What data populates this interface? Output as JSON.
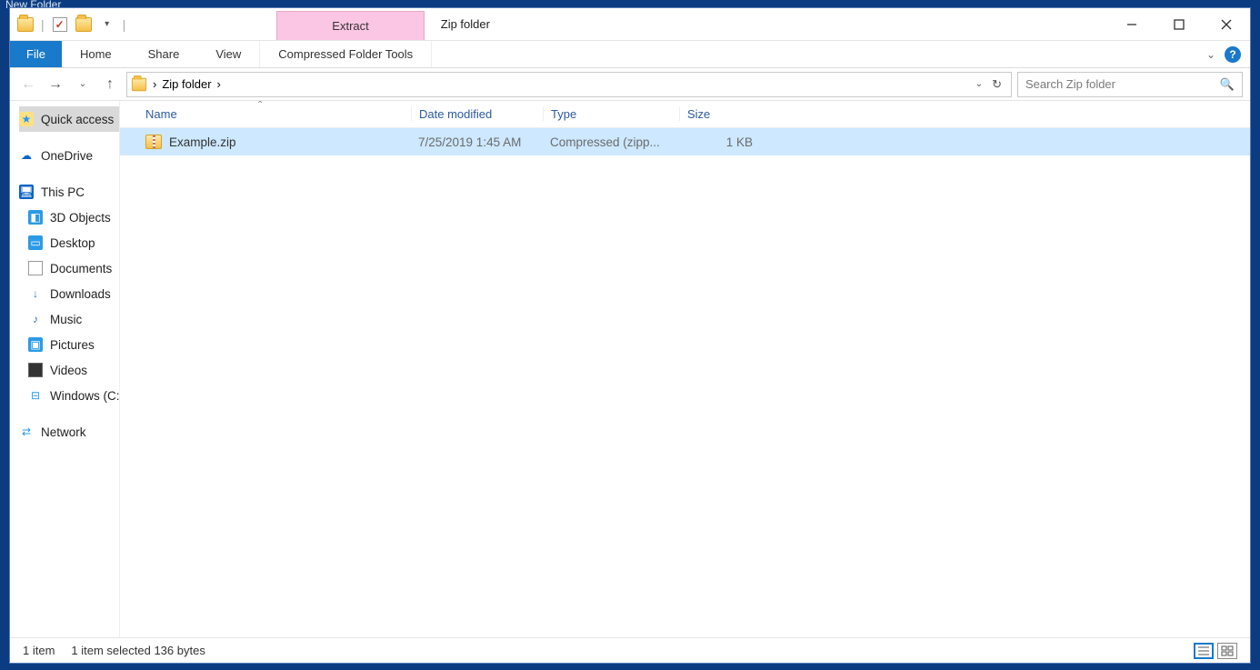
{
  "desktop_label": "New Folder",
  "window": {
    "title": "Zip folder"
  },
  "ribbon": {
    "context_tab": "Extract",
    "tabs": [
      "File",
      "Home",
      "Share",
      "View",
      "Compressed Folder Tools"
    ]
  },
  "address": {
    "crumbs": [
      "Zip folder"
    ]
  },
  "search": {
    "placeholder": "Search Zip folder"
  },
  "nav": {
    "items": [
      "Quick access",
      "OneDrive",
      "This PC",
      "3D Objects",
      "Desktop",
      "Documents",
      "Downloads",
      "Music",
      "Pictures",
      "Videos",
      "Windows (C:)",
      "Network"
    ]
  },
  "columns": [
    "Name",
    "Date modified",
    "Type",
    "Size"
  ],
  "files": [
    {
      "name": "Example.zip",
      "date": "7/25/2019 1:45 AM",
      "type": "Compressed (zipp...",
      "size": "1 KB"
    }
  ],
  "status": {
    "item_count": "1 item",
    "selection": "1 item selected  136 bytes"
  }
}
